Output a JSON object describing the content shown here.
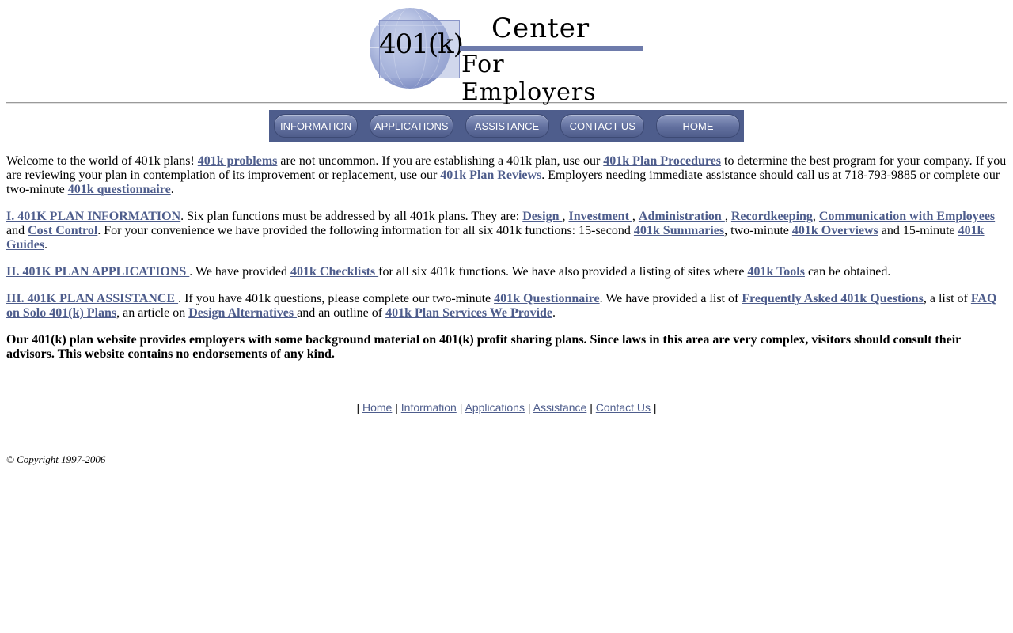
{
  "logo": {
    "mark_text": "401(k)",
    "line1": "Center",
    "line2": "For Employers"
  },
  "nav": [
    {
      "label": "INFORMATION"
    },
    {
      "label": "APPLICATIONS"
    },
    {
      "label": "ASSISTANCE"
    },
    {
      "label": "CONTACT US"
    },
    {
      "label": "HOME"
    }
  ],
  "intro": {
    "t1": "Welcome to the world of 401k plans! ",
    "l1": "401k problems",
    "t2": " are not uncommon. If you are establishing a 401k plan, use our ",
    "l2": "401k Plan Procedures",
    "t3": " to determine the best program for your company. If you are reviewing your plan in contemplation of its improvement or replacement, use our ",
    "l3": "401k Plan Reviews",
    "t4": ". Employers needing immediate assistance should call us at 718-793-9885 or complete our two-minute ",
    "l4": "401k questionnaire",
    "t5": "."
  },
  "section1": {
    "heading": "I. 401K PLAN INFORMATION",
    "t1": ". Six plan functions must be addressed by all 401k plans. They are: ",
    "l_design": "Design ",
    "sep1": ", ",
    "l_investment": "Investment ",
    "sep2": ", ",
    "l_admin": "Administration ",
    "sep3": ", ",
    "l_record": "Recordkeeping",
    "sep4": ", ",
    "l_comm": "Communication with Employees",
    "t2": " and ",
    "l_cost": "Cost Control",
    "t3": ". For your convenience we have provided the following information for all six 401k functions: 15-second ",
    "l_summ": "401k Summaries",
    "t4": ", two-minute ",
    "l_over": "401k Overviews",
    "t5": " and 15-minute ",
    "l_guides": "401k Guides",
    "t6": "."
  },
  "section2": {
    "heading": "II. 401K PLAN APPLICATIONS ",
    "t1": ". We have provided ",
    "l_check": "401k Checklists ",
    "t2": "for all six 401k functions. We have also provided a listing of sites where ",
    "l_tools": "401k Tools",
    "t3": " can be obtained."
  },
  "section3": {
    "heading": "III. 401K PLAN ASSISTANCE ",
    "t1": ". If you have 401k questions, please complete our two-minute ",
    "l_q": "401k Questionnaire",
    "t2": ". We have provided a list of ",
    "l_faq": "Frequently Asked 401k Questions",
    "t3": ", a list of ",
    "l_solo": "FAQ on Solo 401(k) Plans",
    "t4": ", an article on ",
    "l_alt": "Design Alternatives ",
    "t5": "and an outline of ",
    "l_serv": "401k Plan Services We Provide",
    "t6": "."
  },
  "disclaimer": "Our 401(k) plan website provides employers with some background material on 401(k) profit sharing plans. Since laws in this area are very complex, visitors should consult their advisors. This website contains no endorsements of any kind.",
  "footer": {
    "sep": "|",
    "links": [
      "Home",
      "Information",
      "Applications",
      "Assistance",
      "Contact Us"
    ]
  },
  "copyright": "© Copyright 1997-2006",
  "colors": {
    "link": "#4e5d8c",
    "nav_bar": "#4e5d8c"
  }
}
